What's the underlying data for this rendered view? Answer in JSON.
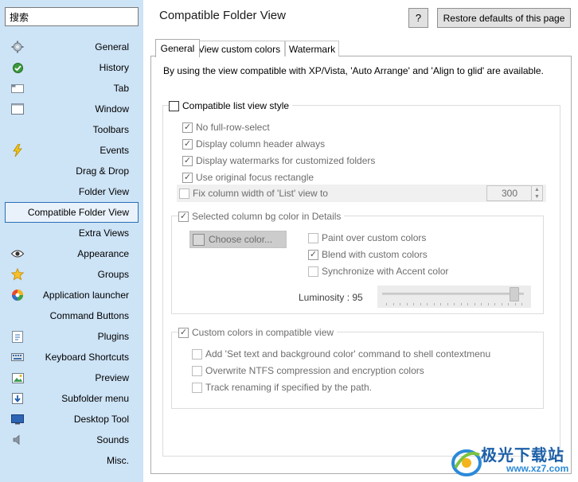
{
  "search": {
    "value": "搜索"
  },
  "sidebar": {
    "items": [
      {
        "label": "General",
        "icon": "gear-icon"
      },
      {
        "label": "History",
        "icon": "history-icon"
      },
      {
        "label": "Tab",
        "icon": "tab-icon"
      },
      {
        "label": "Window",
        "icon": "window-icon"
      },
      {
        "label": "Toolbars",
        "icon": ""
      },
      {
        "label": "Events",
        "icon": "lightning-icon"
      },
      {
        "label": "Drag & Drop",
        "icon": ""
      },
      {
        "label": "Folder View",
        "icon": ""
      },
      {
        "label": "Compatible Folder View",
        "icon": "",
        "selected": true
      },
      {
        "label": "Extra Views",
        "icon": ""
      },
      {
        "label": "Appearance",
        "icon": "eye-icon"
      },
      {
        "label": "Groups",
        "icon": "star-icon"
      },
      {
        "label": "Application launcher",
        "icon": "launcher-icon"
      },
      {
        "label": "Command Buttons",
        "icon": ""
      },
      {
        "label": "Plugins",
        "icon": "plugin-icon"
      },
      {
        "label": "Keyboard Shortcuts",
        "icon": "keyboard-icon"
      },
      {
        "label": "Preview",
        "icon": "picture-icon"
      },
      {
        "label": "Subfolder menu",
        "icon": "down-arrow-icon"
      },
      {
        "label": "Desktop Tool",
        "icon": "monitor-icon"
      },
      {
        "label": "Sounds",
        "icon": "speaker-icon"
      },
      {
        "label": "Misc.",
        "icon": ""
      }
    ]
  },
  "header": {
    "title": "Compatible Folder View",
    "help_label": "?",
    "restore_label": "Restore defaults of this page"
  },
  "tabs": [
    {
      "label": "General",
      "active": true
    },
    {
      "label": "View custom colors",
      "active": false
    },
    {
      "label": "Watermark",
      "active": false
    }
  ],
  "description": "By using the view compatible with XP/Vista, 'Auto Arrange' and 'Align to glid' are available.",
  "compatible_list": {
    "label": "Compatible list view style",
    "checked": false,
    "options": [
      {
        "label": "No full-row-select",
        "checked": true
      },
      {
        "label": "Display column header always",
        "checked": true
      },
      {
        "label": "Display watermarks for customized folders",
        "checked": true
      },
      {
        "label": "Use original focus rectangle",
        "checked": true
      }
    ],
    "fix_width": {
      "label": "Fix column width of 'List' view to",
      "checked": false,
      "value": "300"
    },
    "selected_bg": {
      "label": "Selected column bg color in Details",
      "checked": true,
      "choose_color_label": "Choose color...",
      "options": [
        {
          "label": "Paint over custom colors",
          "checked": false
        },
        {
          "label": "Blend with custom colors",
          "checked": true
        },
        {
          "label": "Synchronize with Accent color",
          "checked": false
        }
      ],
      "luminosity_label": "Luminosity : 95",
      "luminosity_value": 95
    },
    "custom_colors": {
      "label": "Custom colors in compatible view",
      "checked": true,
      "options": [
        {
          "label": "Add 'Set text and background color' command to shell contextmenu",
          "checked": false
        },
        {
          "label": "Overwrite NTFS compression and encryption colors",
          "checked": false
        },
        {
          "label": "Track renaming if specified by the path.",
          "checked": false
        }
      ]
    }
  },
  "watermark_logo": {
    "text": "极光下载站",
    "url": "www.xz7.com"
  },
  "colors": {
    "sidebar_bg": "#cde3f6",
    "selected_border": "#2a6fb6",
    "logo_blue": "#1d5fa8"
  }
}
